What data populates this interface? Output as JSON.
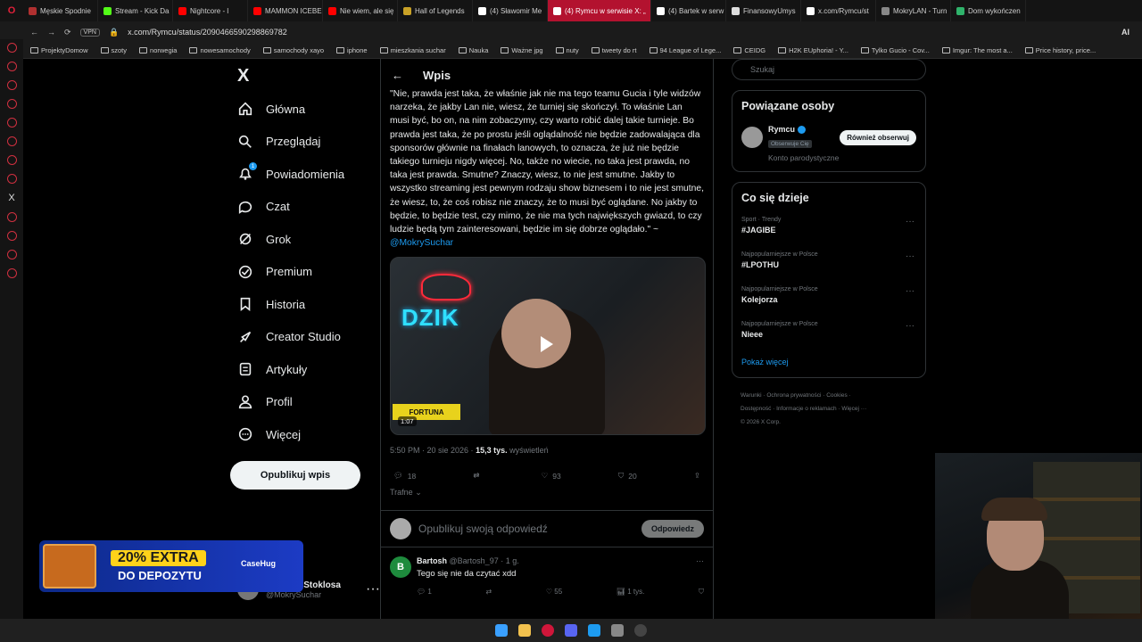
{
  "browser": {
    "tabs": [
      {
        "title": "Męskie Spodnie",
        "color": "#b03030"
      },
      {
        "title": "Stream - Kick Da",
        "color": "#53fc18"
      },
      {
        "title": "Nightcore - l",
        "color": "#ff0000"
      },
      {
        "title": "MAMMON ICEBE",
        "color": "#ff0000"
      },
      {
        "title": "Nie wiem, ale się",
        "color": "#ff0000"
      },
      {
        "title": "Hall of Legends",
        "color": "#c9a227"
      },
      {
        "title": "(4) Sławomir Me",
        "color": "#ffffff"
      },
      {
        "title": "(4) Rymcu w serwisie X: „",
        "color": "#ffffff"
      },
      {
        "title": "(4) Bartek w serw",
        "color": "#ffffff"
      },
      {
        "title": "FinansowyUmys",
        "color": "#dddddd"
      },
      {
        "title": "x.com/Rymcu/st",
        "color": "#ffffff"
      },
      {
        "title": "MokryLAN - Turn",
        "color": "#888888"
      },
      {
        "title": "Dom wykończen",
        "color": "#2fb36b"
      }
    ],
    "active_tab_index": 7,
    "vpn_label": "VPN",
    "url": "x.com/Rymcu/status/2090466590298869782",
    "ai_label": "AI",
    "bookmarks": [
      "ProjektyDomow",
      "szoty",
      "norwegia",
      "nowesamochody",
      "samochody xayo",
      "iphone",
      "mieszkania suchar",
      "Nauka",
      "Ważne jpg",
      "nuty",
      "tweety do rt",
      "94 League of Lege...",
      "CEIDG",
      "H2K EUphoria! - Y...",
      "Tylko Gucio - Cov...",
      "Imgur: The most a...",
      "Price history, price..."
    ]
  },
  "nav": {
    "logo": "X",
    "items": [
      {
        "label": "Główna",
        "icon": "home-icon"
      },
      {
        "label": "Przeglądaj",
        "icon": "search-icon"
      },
      {
        "label": "Powiadomienia",
        "icon": "bell-icon",
        "badge": "1"
      },
      {
        "label": "Czat",
        "icon": "chat-icon"
      },
      {
        "label": "Grok",
        "icon": "grok-icon"
      },
      {
        "label": "Premium",
        "icon": "premium-icon"
      },
      {
        "label": "Historia",
        "icon": "bookmark-icon"
      },
      {
        "label": "Creator Studio",
        "icon": "rocket-icon"
      },
      {
        "label": "Artykuły",
        "icon": "article-icon"
      },
      {
        "label": "Profil",
        "icon": "person-icon"
      },
      {
        "label": "Więcej",
        "icon": "more-icon"
      }
    ],
    "publish_label": "Opublikuj wpis",
    "account": {
      "name": "Dominik Stoklosa",
      "handle": "@MokrySuchar"
    }
  },
  "promo": {
    "headline": "20% EXTRA",
    "sub": "DO DEPOZYTU",
    "brand": "CaseHug"
  },
  "post": {
    "header_title": "Wpis",
    "quote_text": "\"Nie, prawda jest taka, że właśnie jak nie ma tego teamu Gucia i tyle widzów narzeka, że jakby Lan nie, wiesz, że turniej się skończył. To właśnie Lan musi być, bo on, na nim zobaczymy, czy warto robić dalej takie turnieje. Bo prawda jest taka, że po prostu jeśli oglądalność nie będzie zadowalająca dla sponsorów głównie na finałach lanowych, to oznacza, że już nie będzie takiego turnieju nigdy więcej. No, także no wiecie, no taka jest prawda, no taka jest prawda. Smutne? Znaczy, wiesz, to nie jest smutne. Jakby to wszystko streaming jest pewnym rodzaju show biznesem i to nie jest smutne, że wiesz, to, że coś robisz nie znaczy, że to musi być oglądane. No jakby to będzie, to będzie test, czy mimo, że nie ma tych największych gwiazd, to czy ludzie będą tym zainteresowani, będzie im się dobrze oglądało.\" ~ ",
    "mention": "@MokrySuchar",
    "video": {
      "neon_text": "DZIK",
      "sponsor": "FORTUNA",
      "duration": "1:07"
    },
    "time": "5:50 PM · 20 sie 2026 · ",
    "views": "15,3 tys.",
    "views_label": " wyświetleń",
    "stats": {
      "replies": "18",
      "reposts": "",
      "likes": "93",
      "bookmarks": "20"
    },
    "sort_label": "Trafne",
    "reply_placeholder": "Opublikuj swoją odpowiedź",
    "reply_button": "Odpowiedz"
  },
  "comment": {
    "avatar_letter": "B",
    "name": "Bartosh",
    "meta": "@Bartosh_97 · 1 g.",
    "text": "Tego się nie da czytać xdd",
    "replies": "1",
    "reposts": "",
    "likes": "55",
    "views": "1 tys."
  },
  "right": {
    "search_placeholder": "Szukaj",
    "related_title": "Powiązane osoby",
    "related": {
      "name": "Rymcu",
      "badge": "Obserwuje Cię",
      "follow_label": "Również obserwuj",
      "parody": "Konto parodystyczne"
    },
    "trends_title": "Co się dzieje",
    "trends": [
      {
        "category": "Sport · Trendy",
        "title": "#JAGIBE"
      },
      {
        "category": "Najpopularniejsze w Polsce",
        "title": "#LPOTHU"
      },
      {
        "category": "Najpopularniejsze w Polsce",
        "title": "Kolejorza"
      },
      {
        "category": "Najpopularniejsze w Polsce",
        "title": "Nieee"
      }
    ],
    "show_more": "Pokaż więcej",
    "footer": {
      "line1": "Warunki · Ochrona prywatności · Cookies ·",
      "line2": "Dostępność · Informacje o reklamach · Więcej ···",
      "line3": "© 2026 X Corp."
    }
  }
}
